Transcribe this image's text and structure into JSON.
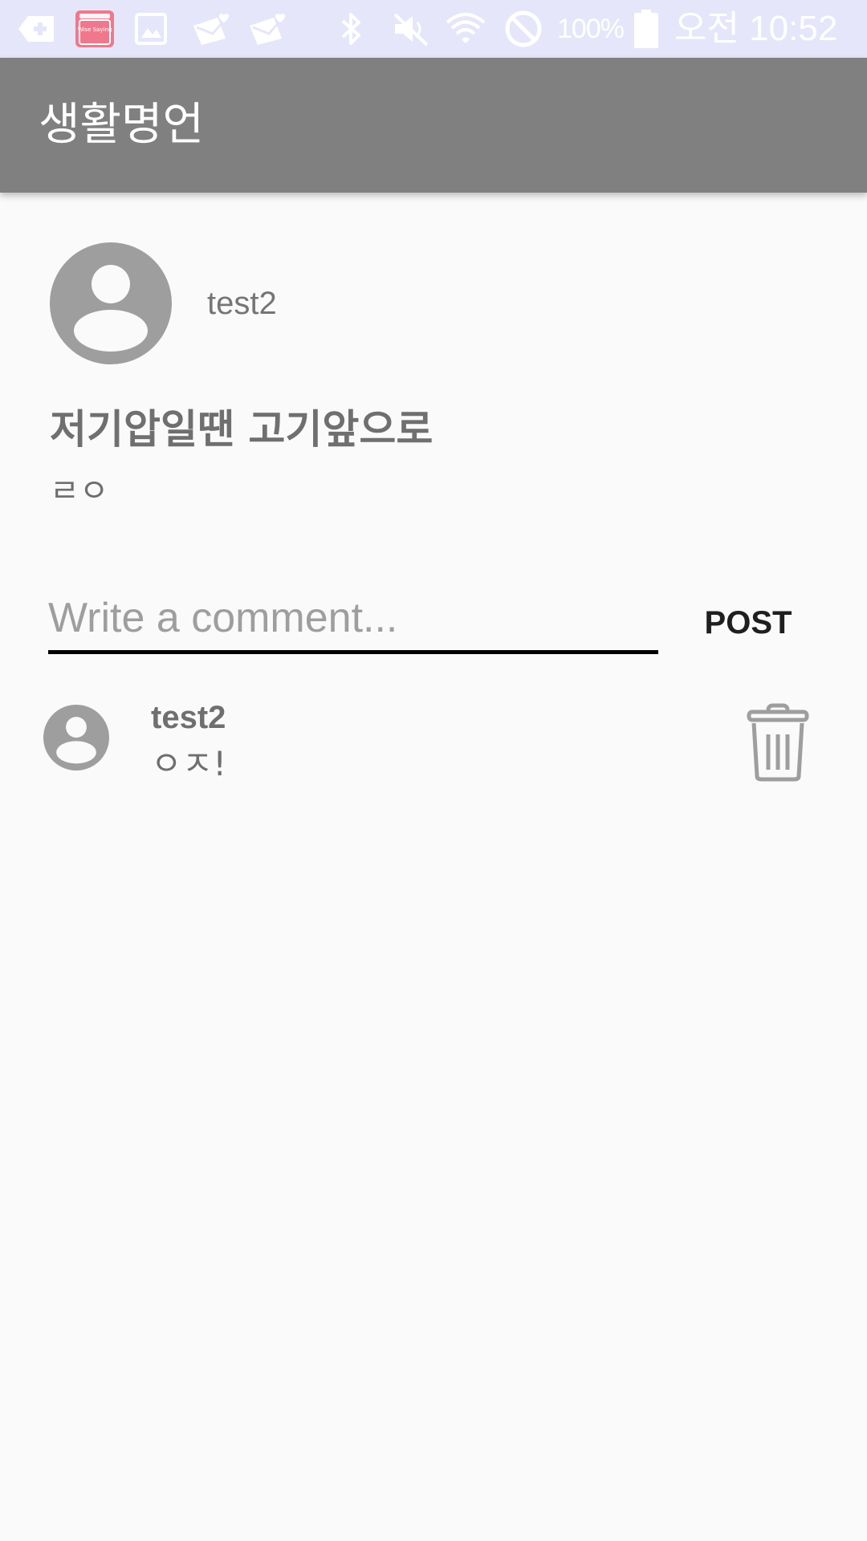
{
  "status_bar": {
    "battery_percent": "100%",
    "time": "오전 10:52",
    "icons": [
      "add-notification-icon",
      "wise-saying-app-icon",
      "image-icon",
      "mail-heart-icon",
      "mail-heart-icon",
      "bluetooth-icon",
      "mute-icon",
      "wifi-icon",
      "do-not-disturb-icon",
      "battery-icon"
    ],
    "wise_saying_icon_text": "Wise Saying"
  },
  "app_bar": {
    "title": "생활명언",
    "color": "#808080"
  },
  "post": {
    "author": "test2",
    "title": "저기압일땐 고기앞으로",
    "body": "ㄹㅇ"
  },
  "comment_form": {
    "placeholder": "Write a comment...",
    "value": "",
    "post_label": "POST"
  },
  "comments": [
    {
      "author": "test2",
      "text": "ㅇㅈ!"
    }
  ],
  "colors": {
    "status_bar_bg": "#e6e6fa",
    "background": "#fafafa",
    "text_gray": "#6f6f6f",
    "avatar_gray": "#9e9e9e",
    "app_icon_pink": "#f0788c"
  }
}
